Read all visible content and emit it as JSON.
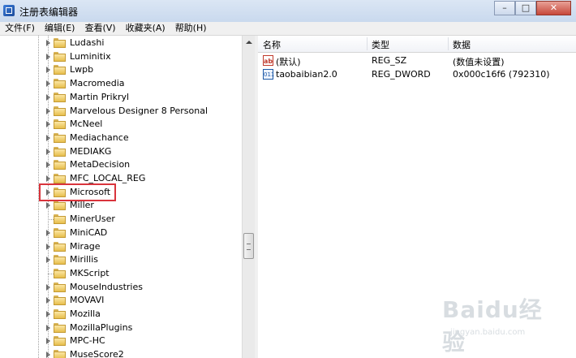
{
  "window": {
    "title": "注册表编辑器",
    "buttons": {
      "minimize": "–",
      "maximize": "□",
      "close": "✕"
    }
  },
  "menu": [
    "文件(F)",
    "编辑(E)",
    "查看(V)",
    "收藏夹(A)",
    "帮助(H)"
  ],
  "tree": {
    "items": [
      {
        "label": "Ludashi",
        "expandable": true
      },
      {
        "label": "Luminitix",
        "expandable": true
      },
      {
        "label": "Lwpb",
        "expandable": true
      },
      {
        "label": "Macromedia",
        "expandable": true
      },
      {
        "label": "Martin Prikryl",
        "expandable": true
      },
      {
        "label": "Marvelous Designer 8 Personal",
        "expandable": true
      },
      {
        "label": "McNeel",
        "expandable": true
      },
      {
        "label": "Mediachance",
        "expandable": true
      },
      {
        "label": "MEDIAKG",
        "expandable": true
      },
      {
        "label": "MetaDecision",
        "expandable": true
      },
      {
        "label": "MFC_LOCAL_REG",
        "expandable": true
      },
      {
        "label": "Microsoft",
        "expandable": true,
        "highlighted": true
      },
      {
        "label": "Miller",
        "expandable": true
      },
      {
        "label": "MinerUser",
        "expandable": false
      },
      {
        "label": "MiniCAD",
        "expandable": true
      },
      {
        "label": "Mirage",
        "expandable": true
      },
      {
        "label": "Mirillis",
        "expandable": true
      },
      {
        "label": "MKScript",
        "expandable": false
      },
      {
        "label": "MouseIndustries",
        "expandable": true
      },
      {
        "label": "MOVAVI",
        "expandable": true
      },
      {
        "label": "Mozilla",
        "expandable": true
      },
      {
        "label": "MozillaPlugins",
        "expandable": true
      },
      {
        "label": "MPC-HC",
        "expandable": true
      },
      {
        "label": "MuseScore2",
        "expandable": true
      }
    ]
  },
  "list": {
    "columns": [
      "名称",
      "类型",
      "数据"
    ],
    "rows": [
      {
        "icon": "string-value-icon",
        "icon_glyph": "ab",
        "name": "(默认)",
        "type": "REG_SZ",
        "data": "(数值未设置)"
      },
      {
        "icon": "dword-value-icon",
        "icon_glyph": "011",
        "name": "taobaibian2.0",
        "type": "REG_DWORD",
        "data": "0x000c16f6 (792310)"
      }
    ]
  },
  "watermark": {
    "logo": "Baidu经验",
    "sub": "jingyan.baidu.com"
  },
  "colors": {
    "highlight_box": "#d9343c",
    "folder": "#e7bf4c"
  }
}
